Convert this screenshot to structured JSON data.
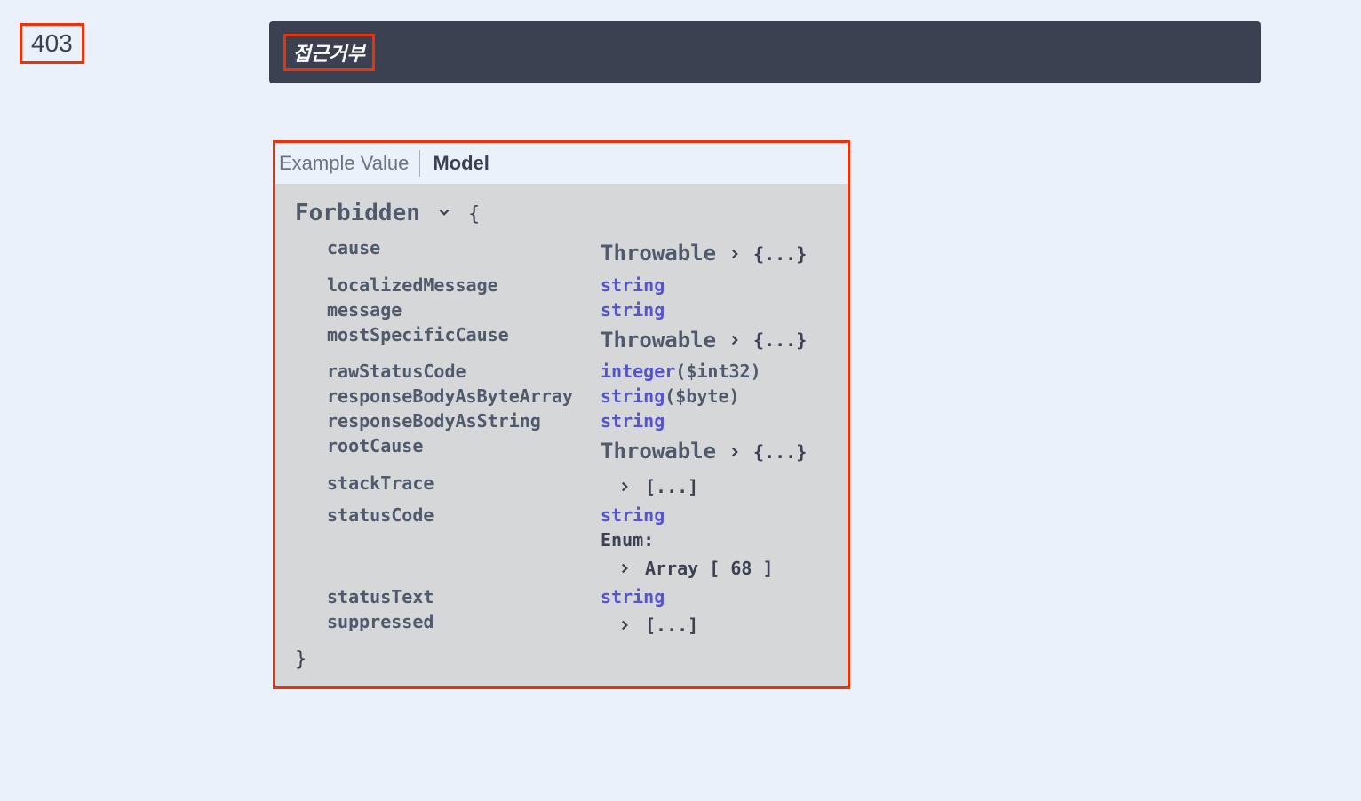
{
  "status_code": "403",
  "description": "접근거부",
  "tabs": {
    "example": "Example Value",
    "model": "Model"
  },
  "model": {
    "name": "Forbidden",
    "open_brace": "{",
    "close_brace": "}",
    "properties": [
      {
        "name": "cause",
        "value_type": "ref",
        "ref": "Throwable",
        "collapsed": "{...}"
      },
      {
        "name": "localizedMessage",
        "value_type": "primitive",
        "ptype": "string"
      },
      {
        "name": "message",
        "value_type": "primitive",
        "ptype": "string"
      },
      {
        "name": "mostSpecificCause",
        "value_type": "ref",
        "ref": "Throwable",
        "collapsed": "{...}"
      },
      {
        "name": "rawStatusCode",
        "value_type": "primitive",
        "ptype": "integer",
        "format": "($int32)"
      },
      {
        "name": "responseBodyAsByteArray",
        "value_type": "primitive",
        "ptype": "string",
        "format": "($byte)"
      },
      {
        "name": "responseBodyAsString",
        "value_type": "primitive",
        "ptype": "string"
      },
      {
        "name": "rootCause",
        "value_type": "ref",
        "ref": "Throwable",
        "collapsed": "{...}"
      },
      {
        "name": "stackTrace",
        "value_type": "array-collapsed",
        "collapsed": "[...]"
      },
      {
        "name": "statusCode",
        "value_type": "enum",
        "ptype": "string",
        "enum_label": "Enum:",
        "array_text": "Array [ 68 ]"
      },
      {
        "name": "statusText",
        "value_type": "primitive",
        "ptype": "string"
      },
      {
        "name": "suppressed",
        "value_type": "array-collapsed",
        "collapsed": "[...]"
      }
    ]
  }
}
